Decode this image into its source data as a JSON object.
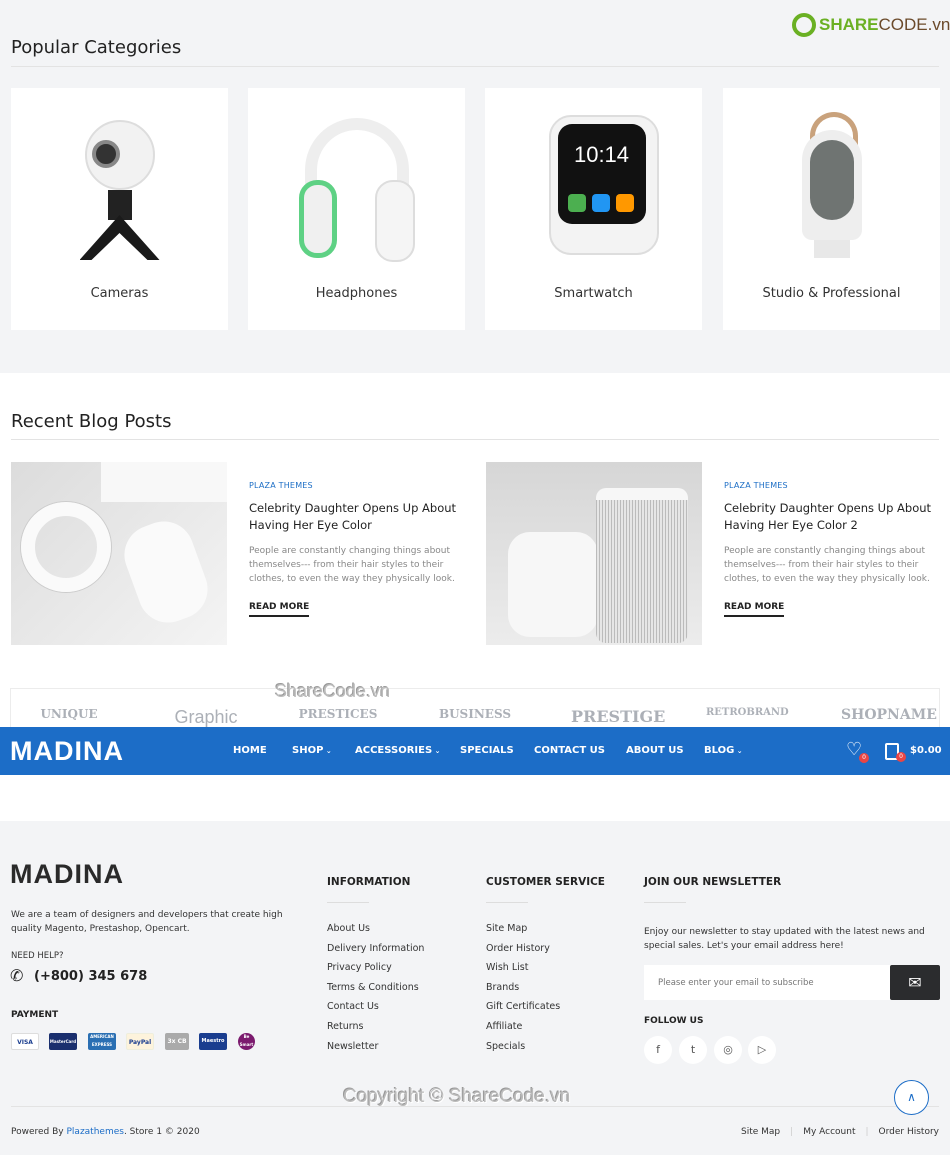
{
  "watermark_logo": {
    "text": "SHARECODE.vn",
    "brand_color": "#6ab023"
  },
  "popular": {
    "title": "Popular Categories",
    "items": [
      {
        "label": "Cameras",
        "icon": "360-camera"
      },
      {
        "label": "Headphones",
        "icon": "headphones"
      },
      {
        "label": "Smartwatch",
        "icon": "smartwatch",
        "screen_time": "10:14"
      },
      {
        "label": "Studio & Professional",
        "icon": "speaker"
      }
    ]
  },
  "blog": {
    "title": "Recent Blog Posts",
    "posts": [
      {
        "category": "PLAZA THEMES",
        "title": "Celebrity Daughter Opens Up About Having Her Eye Color",
        "excerpt": "People are constantly changing things about themselves--- from their hair styles to their clothes, to even the way they physically look.",
        "read_more": "READ MORE"
      },
      {
        "category": "PLAZA THEMES",
        "title": "Celebrity Daughter Opens Up About Having Her Eye Color 2",
        "excerpt": "People are constantly changing things about themselves--- from their hair styles to their clothes, to even the way they physically look.",
        "read_more": "READ MORE"
      }
    ]
  },
  "brands": [
    "UNIQUE",
    "Graphic",
    "PRESTICES",
    "BUSINESS",
    "PRESTIGE",
    "RETROBRAND",
    "SHOPNAME"
  ],
  "watermark_mid": "ShareCode.vn",
  "nav": {
    "logo": "MADINA",
    "accent": "#1c6dc7",
    "items": [
      {
        "label": "HOME",
        "dropdown": false
      },
      {
        "label": "SHOP",
        "dropdown": true
      },
      {
        "label": "ACCESSORIES",
        "dropdown": true
      },
      {
        "label": "SPECIALS",
        "dropdown": false
      },
      {
        "label": "CONTACT US",
        "dropdown": false
      },
      {
        "label": "ABOUT US",
        "dropdown": false
      },
      {
        "label": "BLOG",
        "dropdown": true
      }
    ],
    "wishlist_count": "0",
    "cart_count": "0",
    "cart_total": "$0.00"
  },
  "footer": {
    "logo": "MADINA",
    "about": "We are a team of designers and developers that create high quality Magento, Prestashop, Opencart.",
    "help_label": "NEED HELP?",
    "phone": "(+800) 345 678",
    "payment_label": "PAYMENT",
    "payments": [
      "VISA",
      "MasterCard",
      "AMERICAN EXPRESS",
      "PayPal",
      "3x CB",
      "Maestro",
      "Be Smart"
    ],
    "information": {
      "title": "INFORMATION",
      "links": [
        "About Us",
        "Delivery Information",
        "Privacy Policy",
        "Terms & Conditions",
        "Contact Us",
        "Returns",
        "Newsletter"
      ]
    },
    "customer_service": {
      "title": "CUSTOMER SERVICE",
      "links": [
        "Site Map",
        "Order History",
        "Wish List",
        "Brands",
        "Gift Certificates",
        "Affiliate",
        "Specials"
      ]
    },
    "newsletter": {
      "title": "JOIN OUR NEWSLETTER",
      "text": "Enjoy our newsletter to stay updated with the latest news and special sales. Let's your email address here!",
      "placeholder": "Please enter your email to subscribe"
    },
    "follow_label": "FOLLOW US",
    "social": [
      "facebook",
      "twitter",
      "instagram",
      "youtube"
    ],
    "copyright_watermark": "Copyright © ShareCode.vn",
    "powered_prefix": "Powered By ",
    "powered_link": "Plazathemes",
    "powered_suffix": ". Store 1 © 2020",
    "bottom_links": [
      "Site Map",
      "My Account",
      "Order History"
    ]
  }
}
